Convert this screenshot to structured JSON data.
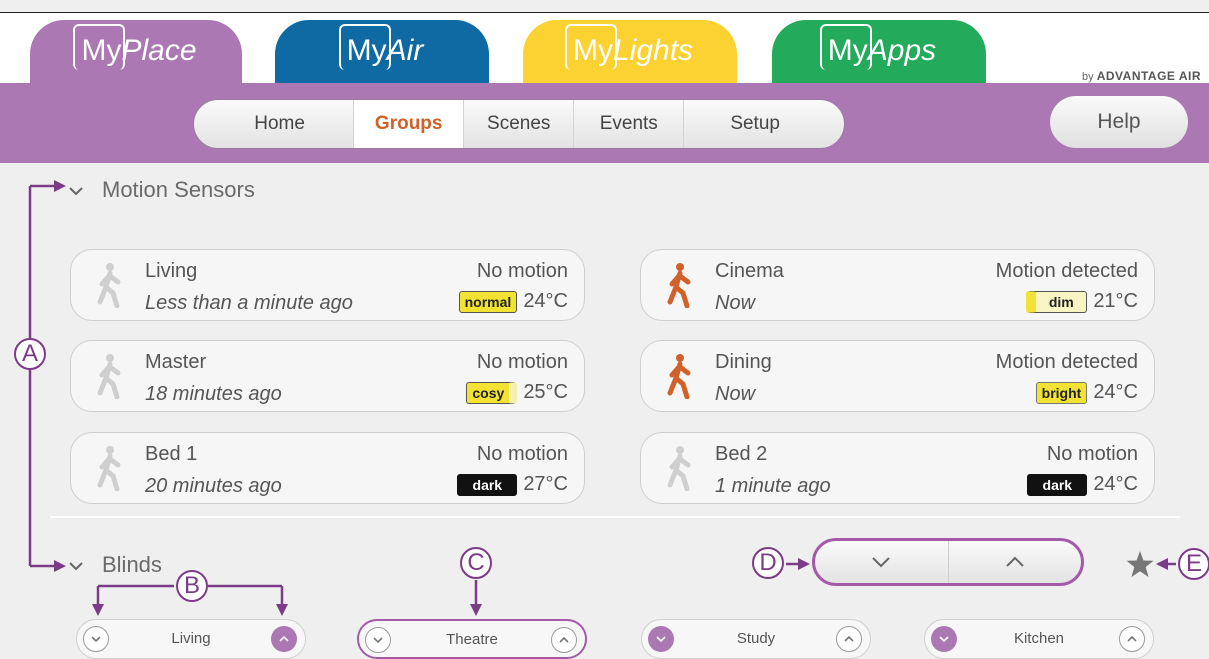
{
  "apps": [
    {
      "my": "My",
      "name": "Place",
      "color": "#ac78b4"
    },
    {
      "my": "My",
      "name": "Air",
      "color": "#0f6aa4"
    },
    {
      "my": "My",
      "name": "Lights",
      "color": "#fbd232"
    },
    {
      "my": "My",
      "name": "Apps",
      "color": "#23aa5a"
    }
  ],
  "brand": {
    "by": "by",
    "name": "ADVANTAGE AIR"
  },
  "nav": {
    "items": [
      "Home",
      "Groups",
      "Scenes",
      "Events",
      "Setup"
    ],
    "active": "Groups"
  },
  "help_label": "Help",
  "motion": {
    "title": "Motion Sensors",
    "sensors": [
      {
        "name": "Living",
        "time": "Less than a minute ago",
        "status": "No motion",
        "badge": "normal",
        "temp": "24°C",
        "active": false
      },
      {
        "name": "Cinema",
        "time": "Now",
        "status": "Motion detected",
        "badge": "dim",
        "temp": "21°C",
        "active": true
      },
      {
        "name": "Master",
        "time": "18 minutes ago",
        "status": "No motion",
        "badge": "cosy",
        "temp": "25°C",
        "active": false
      },
      {
        "name": "Dining",
        "time": "Now",
        "status": "Motion detected",
        "badge": "bright",
        "temp": "24°C",
        "active": true
      },
      {
        "name": "Bed 1",
        "time": "20 minutes ago",
        "status": "No motion",
        "badge": "dark",
        "temp": "27°C",
        "active": false
      },
      {
        "name": "Bed 2",
        "time": "1 minute ago",
        "status": "No motion",
        "badge": "dark",
        "temp": "24°C",
        "active": false
      }
    ]
  },
  "blinds": {
    "title": "Blinds",
    "items": [
      {
        "name": "Living",
        "down": false,
        "up": true
      },
      {
        "name": "Theatre",
        "down": false,
        "up": false
      },
      {
        "name": "Study",
        "down": true,
        "up": false
      },
      {
        "name": "Kitchen",
        "down": true,
        "up": false
      }
    ]
  },
  "annotations": [
    "A",
    "B",
    "C",
    "D",
    "E"
  ],
  "colors": {
    "accent": "#ac78b4",
    "annotation": "#7b3b87",
    "active_nav": "#d1612a",
    "motion_active": "#d1612a",
    "motion_idle": "#cfcfcf"
  }
}
